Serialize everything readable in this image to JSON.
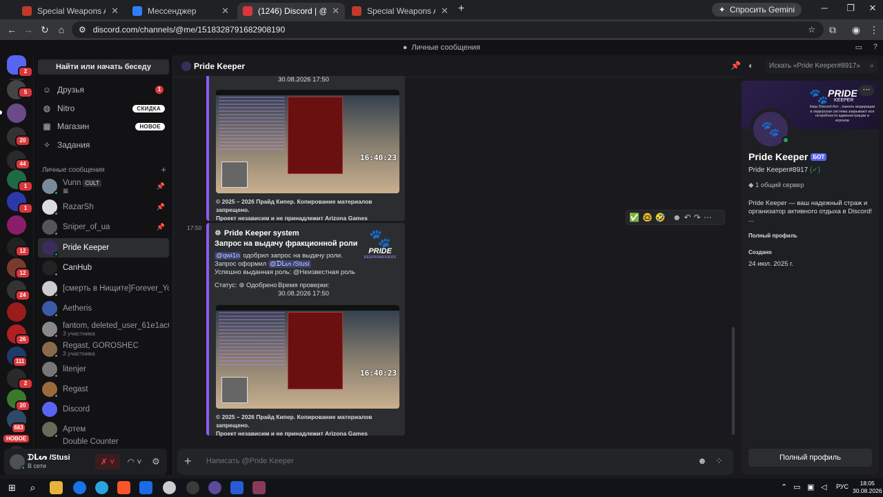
{
  "browser": {
    "tabs": [
      {
        "title": "Special Weapons Attack Team |...",
        "active": false
      },
      {
        "title": "Мессенджер",
        "active": false
      },
      {
        "title": "(1246) Discord | @Pride Keeper",
        "active": true
      },
      {
        "title": "Special Weapons Attack Team |...",
        "active": false
      }
    ],
    "new_tab": "+",
    "gemini_label": "Спросить Gemini",
    "url": "discord.com/channels/@me/1518328791682908190"
  },
  "discord": {
    "topbar_title": "Личные сообщения",
    "rail_badges": [
      "2",
      "5",
      "20",
      "44",
      "1",
      "1",
      "12",
      "12",
      "24",
      "26",
      "111",
      "2",
      "20",
      "683"
    ],
    "rail_new_label": "НОВОЕ",
    "dm_search": "Найти или начать беседу",
    "nav": {
      "friends": "Друзья",
      "friends_count": "1",
      "nitro": "Nitro",
      "nitro_pill": "СКИДКА",
      "shop": "Магазин",
      "shop_pill": "НОВОЕ",
      "quests": "Задания"
    },
    "dm_header": "Личные сообщения",
    "dm_add": "+",
    "dms": [
      {
        "name": "Vunn",
        "tag": "CULT"
      },
      {
        "name": "RazarSh"
      },
      {
        "name": "Sniper_of_ua"
      },
      {
        "name": "Pride Keeper"
      },
      {
        "name": "CanHub"
      },
      {
        "name": "[смерть в Нищите]Forever_You..."
      },
      {
        "name": "Aetheris"
      },
      {
        "name": "fantom, deleted_user_61e1ac6b...",
        "sub": "3 участника"
      },
      {
        "name": "Regast, GOROSHEC",
        "sub": "3 участника"
      },
      {
        "name": "litenjer"
      },
      {
        "name": "Regast"
      },
      {
        "name": "Discord"
      },
      {
        "name": "Артем"
      },
      {
        "name": "Double Counter"
      }
    ],
    "user": {
      "name": "ᗪᒪᔕ /Stusi",
      "status": "В сети"
    },
    "chat": {
      "title": "Pride Keeper",
      "search_placeholder": "Искать «Pride Keeper#8917»",
      "top_embed": {
        "check_time": "30.08.2026 17:50",
        "clock": "16:40:23",
        "footer1": "© 2025 – 2026 Прайд Кипер. Копирование материалов запрещено.",
        "footer2": "Проект независим и не принадлежит Arizona Games"
      },
      "message_time": "17:50",
      "embed": {
        "author": "Pride Keeper system",
        "title": "Запрос на выдачу фракционной роли",
        "mention1": "@qwi1n",
        "line1_rest": " одобрил запрос на выдачу роли.",
        "line2_prefix": "Запрос оформил ",
        "mention2": "@ᗪᒪᔕ /Stusi",
        "line3": "Успешно выданная роль: @Неизвестная роль",
        "status_label": "Статус:",
        "status_value": "Одобрено",
        "check_label": "Время проверки:",
        "check_time": "30.08.2026 17:50",
        "logo_text": "PRIDE",
        "logo_sub": "KEEPERMODERS",
        "clock": "16:40:23",
        "footer1": "© 2025 – 2026 Прайд Кипер. Копирование материалов запрещено.",
        "footer2": "Проект независим и не принадлежит Arizona Games"
      },
      "reactions": [
        "✅",
        "🤓",
        "🤣",
        "☻",
        "↶",
        "↷",
        "⋯"
      ],
      "composer_placeholder": "Написать @Pride Keeper"
    },
    "profile": {
      "banner_title": "PRIDE",
      "banner_sub": "KEEPER",
      "banner_text": "Наш Discord-бот , панель модерации и лидерская система закрывают все потребности администрации и игроков",
      "name": "Pride Keeper",
      "bot_tag": "БОТ",
      "handle": "Pride Keeper#8917",
      "handle_tag": "{✓}",
      "mutual": "1 общий сервер",
      "bio": "Pride Keeper — ваш надежный страж и организатор активного отдыха в Discord!",
      "bio_more": "...",
      "full_profile_small": "Полный профиль",
      "created_label": "Создано",
      "created_value": "24 июл. 2025 г.",
      "full_profile_button": "Полный профиль"
    }
  },
  "taskbar": {
    "lang": "РУС",
    "time": "18:05",
    "date": "30.08.2026"
  },
  "colors": {
    "accent": "#8b5cf6",
    "danger": "#da373c",
    "online": "#23a559",
    "blurple": "#5865f2"
  }
}
